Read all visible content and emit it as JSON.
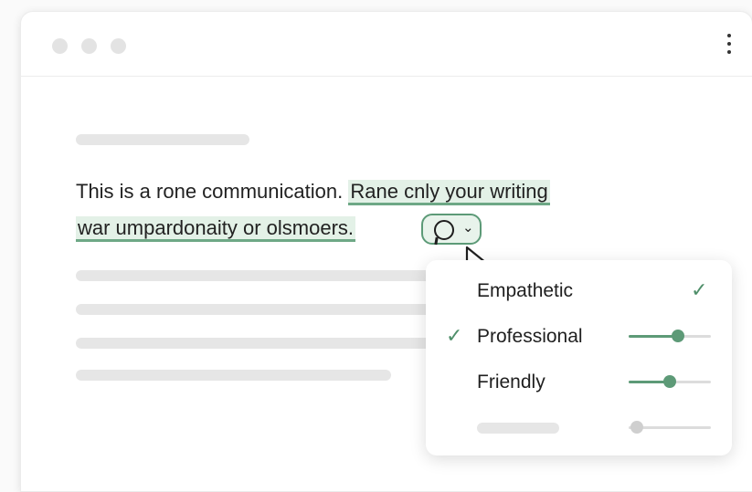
{
  "editor": {
    "line1_plain": "This is a rone communication.",
    "line1_highlight": "Rane cnly your writing",
    "line2_highlight": "war umpardonaity or olsmoers."
  },
  "tone_menu": {
    "items": [
      {
        "label": "Empathetic",
        "checked_right": true
      },
      {
        "label": "Professional",
        "checked_left": true,
        "level": 0.6
      },
      {
        "label": "Friendly",
        "level": 0.5
      },
      {
        "label": "",
        "level": 0.1,
        "disabled": true
      }
    ],
    "check_glyph": "✓"
  },
  "colors": {
    "accent": "#5d9a77",
    "highlight_bg": "#e3f1e7"
  },
  "icons": {
    "tone_chip": "speech-bubble-icon",
    "chip_caret": "chevron-down-icon",
    "window_menu": "more-vertical-icon"
  }
}
